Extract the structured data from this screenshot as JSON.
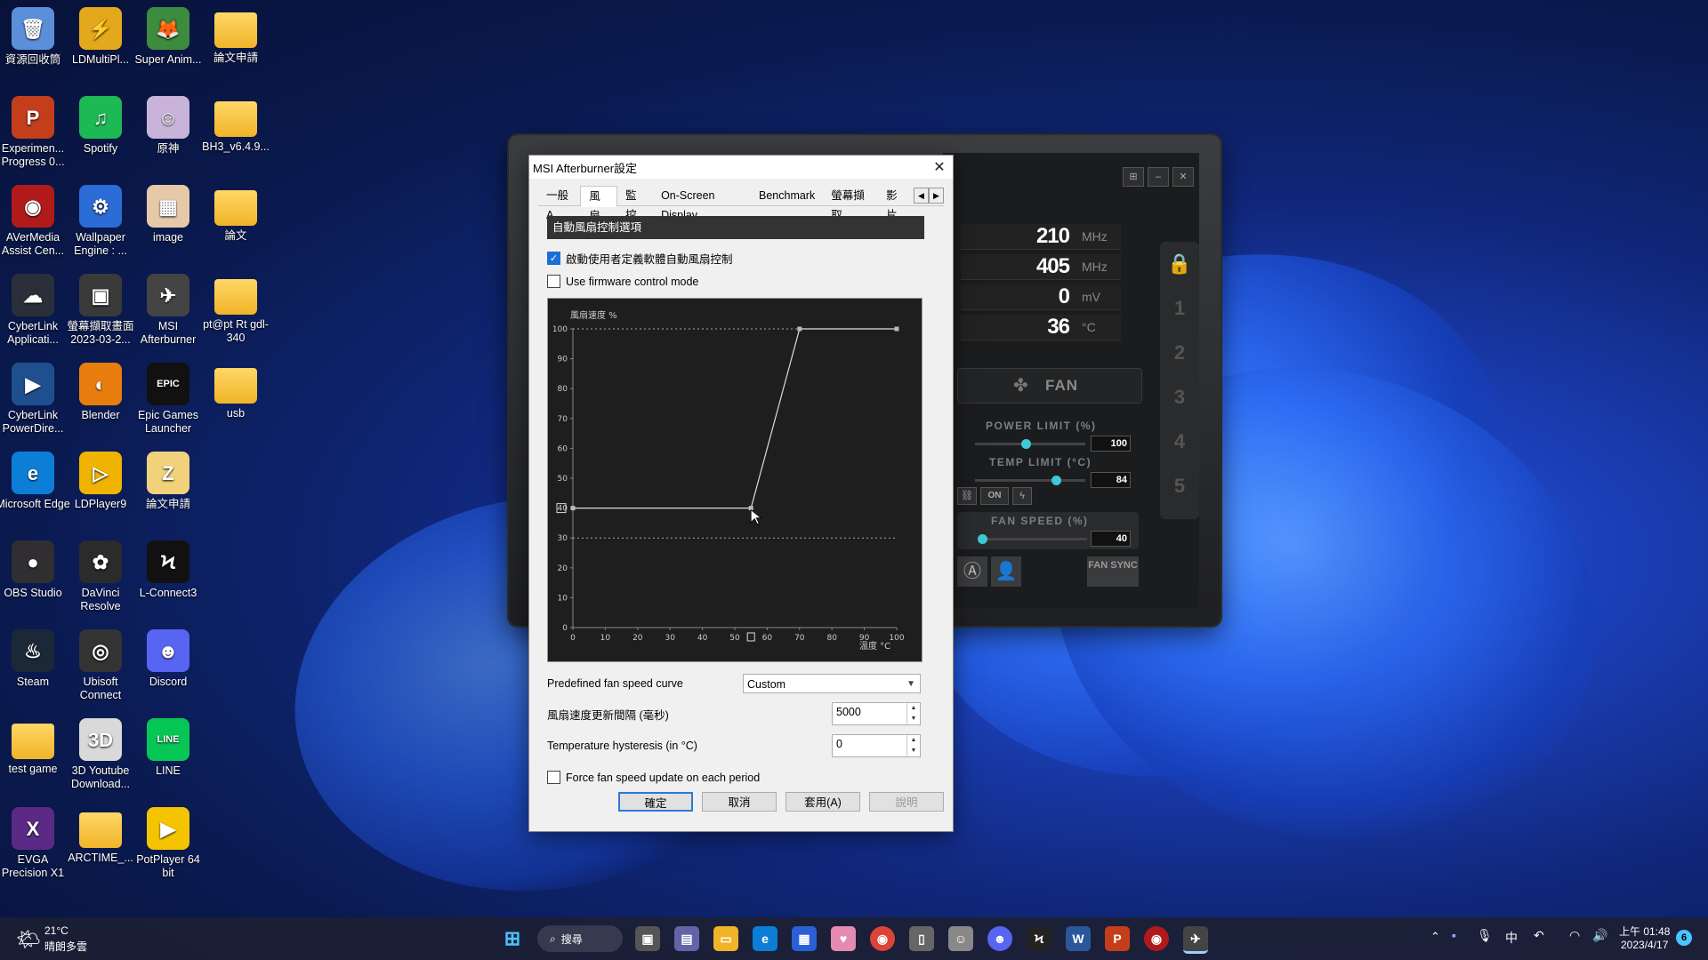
{
  "desktop": {
    "icons": [
      {
        "label": "資源回收筒",
        "glyph": "🗑",
        "color": "#5b8fd9",
        "type": "app"
      },
      {
        "label": "LDMultiPl...",
        "glyph": "⚡",
        "color": "#e3a81b",
        "type": "app"
      },
      {
        "label": "Super Anim...",
        "glyph": "🦊",
        "color": "#3d8b3d",
        "type": "app"
      },
      {
        "label": "論文申請",
        "glyph": "",
        "color": "",
        "type": "folder"
      },
      {
        "label": "Experimen... Progress 0...",
        "glyph": "P",
        "color": "#c43e1c",
        "type": "app"
      },
      {
        "label": "Spotify",
        "glyph": "♫",
        "color": "#1db954",
        "type": "app"
      },
      {
        "label": "原神",
        "glyph": "☺",
        "color": "#c9b3d9",
        "type": "app"
      },
      {
        "label": "BH3_v6.4.9...",
        "glyph": "",
        "color": "",
        "type": "folder"
      },
      {
        "label": "AVerMedia Assist Cen...",
        "glyph": "◉",
        "color": "#b01a1a",
        "type": "app"
      },
      {
        "label": "Wallpaper Engine : ...",
        "glyph": "⚙",
        "color": "#2b6cd6",
        "type": "app"
      },
      {
        "label": "image",
        "glyph": "▦",
        "color": "#e6c9a8",
        "type": "app"
      },
      {
        "label": "論文",
        "glyph": "",
        "color": "",
        "type": "folder"
      },
      {
        "label": "CyberLink Applicati...",
        "glyph": "☁",
        "color": "#2a2f3a",
        "type": "app"
      },
      {
        "label": "螢幕擷取畫面 2023-03-2...",
        "glyph": "▣",
        "color": "#3a3a3a",
        "type": "app"
      },
      {
        "label": "MSI Afterburner",
        "glyph": "✈",
        "color": "#444",
        "type": "app"
      },
      {
        "label": "pt@pt Rt gdl-340",
        "glyph": "",
        "color": "",
        "type": "folder"
      },
      {
        "label": "CyberLink PowerDire...",
        "glyph": "▶",
        "color": "#1f4f8f",
        "type": "app"
      },
      {
        "label": "Blender",
        "glyph": "◐",
        "color": "#e87d0d",
        "type": "app"
      },
      {
        "label": "Epic Games Launcher",
        "glyph": "EPIC",
        "color": "#111",
        "type": "app"
      },
      {
        "label": "usb",
        "glyph": "",
        "color": "",
        "type": "folder"
      },
      {
        "label": "Microsoft Edge",
        "glyph": "e",
        "color": "#0c7ed6",
        "type": "app"
      },
      {
        "label": "LDPlayer9",
        "glyph": "▷",
        "color": "#f0b400",
        "type": "app"
      },
      {
        "label": "論文申請",
        "glyph": "Z",
        "color": "#f1d27a",
        "type": "app"
      },
      {
        "label": "",
        "glyph": "",
        "color": "",
        "type": "none"
      },
      {
        "label": "OBS Studio",
        "glyph": "●",
        "color": "#302e31",
        "type": "app"
      },
      {
        "label": "DaVinci Resolve",
        "glyph": "✿",
        "color": "#2b2b2b",
        "type": "app"
      },
      {
        "label": "L-Connect3",
        "glyph": "Ϟ",
        "color": "#111",
        "type": "app"
      },
      {
        "label": "",
        "glyph": "",
        "color": "",
        "type": "none"
      },
      {
        "label": "Steam",
        "glyph": "♨",
        "color": "#1b2838",
        "type": "app"
      },
      {
        "label": "Ubisoft Connect",
        "glyph": "◎",
        "color": "#333",
        "type": "app"
      },
      {
        "label": "Discord",
        "glyph": "☻",
        "color": "#5865f2",
        "type": "app"
      },
      {
        "label": "",
        "glyph": "",
        "color": "",
        "type": "none"
      },
      {
        "label": "test game",
        "glyph": "",
        "color": "",
        "type": "folder"
      },
      {
        "label": "3D Youtube Download...",
        "glyph": "3D",
        "color": "#d9d9d9",
        "type": "app"
      },
      {
        "label": "LINE",
        "glyph": "LINE",
        "color": "#06c755",
        "type": "app"
      },
      {
        "label": "",
        "glyph": "",
        "color": "",
        "type": "none"
      },
      {
        "label": "EVGA Precision X1",
        "glyph": "X",
        "color": "#5b2a86",
        "type": "app"
      },
      {
        "label": "ARCTIME_...",
        "glyph": "",
        "color": "",
        "type": "folder"
      },
      {
        "label": "PotPlayer 64 bit",
        "glyph": "▶",
        "color": "#f5c400",
        "type": "app"
      }
    ]
  },
  "afterburner": {
    "readouts": [
      {
        "value": "210",
        "unit": "MHz"
      },
      {
        "value": "405",
        "unit": "MHz"
      },
      {
        "value": "0",
        "unit": "mV"
      },
      {
        "value": "36",
        "unit": "°C"
      }
    ],
    "fan_label": "FAN",
    "power_limit_label": "POWER LIMIT (%)",
    "power_limit_value": "100",
    "power_limit_level": 100,
    "temp_limit_label": "TEMP LIMIT (°C)",
    "temp_limit_value": "84",
    "temp_limit_level": 84,
    "on_label": "ON",
    "fan_speed_label": "FAN SPEED (%)",
    "fan_speed_value": "40",
    "fan_speed_level": 40,
    "fan_sync_label": "FAN SYNC",
    "profiles": [
      "1",
      "2",
      "3",
      "4",
      "5"
    ]
  },
  "dialog": {
    "title": "MSI Afterburner設定",
    "tabs": [
      "一般A",
      "風扇",
      "監控",
      "On-Screen Display",
      "Benchmark",
      "螢幕擷取",
      "影片"
    ],
    "active_tab": "風扇",
    "section_title": "自動風扇控制選項",
    "enable_custom_label": "啟動使用者定義軟體自動風扇控制",
    "enable_custom_checked": true,
    "firmware_label": "Use firmware control mode",
    "firmware_checked": false,
    "predefined_label": "Predefined fan speed curve",
    "predefined_value": "Custom",
    "update_period_label": "風扇速度更新間隔 (毫秒)",
    "update_period_value": "5000",
    "hysteresis_label": "Temperature hysteresis (in °C)",
    "hysteresis_value": "0",
    "force_update_label": "Force fan speed update on each period",
    "force_update_checked": false,
    "ok_label": "確定",
    "cancel_label": "取消",
    "apply_label": "套用(A)",
    "help_label": "說明"
  },
  "chart_data": {
    "type": "line",
    "ylabel": "風扇速度 %",
    "xlabel": "溫度 °C",
    "xlim": [
      0,
      100
    ],
    "ylim": [
      0,
      100
    ],
    "x_ticks": [
      0,
      10,
      20,
      30,
      40,
      50,
      60,
      70,
      80,
      90,
      100
    ],
    "y_ticks": [
      0,
      10,
      20,
      30,
      40,
      50,
      60,
      70,
      80,
      90,
      100
    ],
    "series": [
      {
        "points": [
          [
            0,
            40
          ],
          [
            55,
            40
          ],
          [
            70,
            100
          ],
          [
            100,
            100
          ]
        ]
      }
    ],
    "reference_lines": [
      100,
      30
    ],
    "current_x_marker": 55,
    "current_y_marker": 40
  },
  "taskbar": {
    "weather_temp": "21°C",
    "weather_desc": "晴朗多雲",
    "search_label": "搜尋",
    "time": "上午 01:48",
    "date": "2023/4/17",
    "ime": "中",
    "notification_count": "6"
  }
}
